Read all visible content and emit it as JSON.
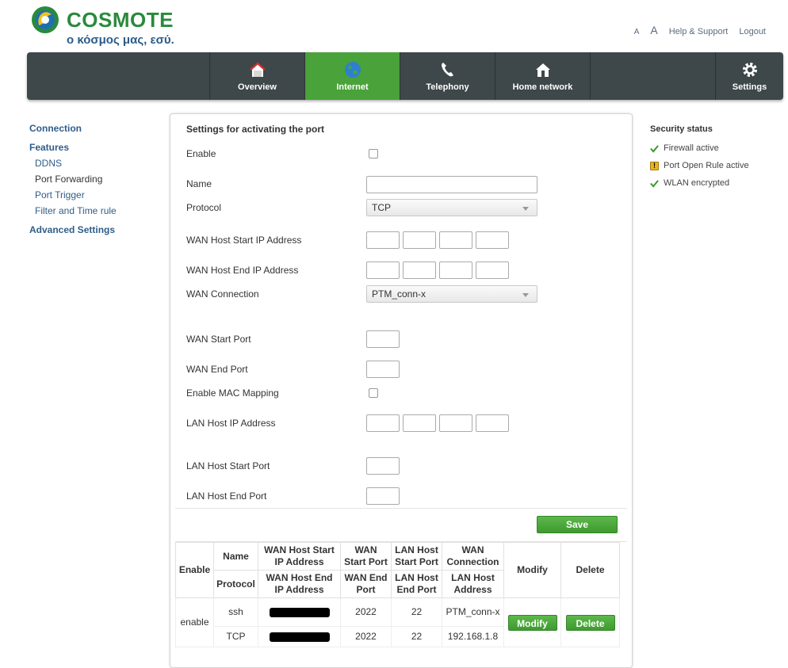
{
  "brand": {
    "name": "COSMOTE",
    "slogan": "ο κόσμος μας, εσύ."
  },
  "top_links": {
    "font_small": "A",
    "font_large": "A",
    "help": "Help & Support",
    "logout": "Logout"
  },
  "nav": {
    "overview": "Overview",
    "internet": "Internet",
    "telephony": "Telephony",
    "home_network": "Home network",
    "settings": "Settings",
    "active_color": "#4aa23a"
  },
  "sidebar": {
    "connection": "Connection",
    "features": "Features",
    "items": [
      "DDNS",
      "Port Forwarding",
      "Port Trigger",
      "Filter and Time rule"
    ],
    "advanced": "Advanced Settings"
  },
  "form": {
    "title": "Settings for activating the port",
    "enable": "Enable",
    "name": "Name",
    "protocol": "Protocol",
    "protocol_value": "TCP",
    "wan_start_ip": "WAN Host Start IP Address",
    "wan_end_ip": "WAN Host End IP Address",
    "wan_connection": "WAN Connection",
    "wan_connection_value": "PTM_conn-x",
    "wan_start_port": "WAN Start Port",
    "wan_end_port": "WAN End Port",
    "enable_mac": "Enable MAC Mapping",
    "lan_ip": "LAN Host IP Address",
    "lan_start_port": "LAN Host Start Port",
    "lan_end_port": "LAN Host End Port",
    "save": "Save"
  },
  "table": {
    "h_enable": "Enable",
    "h_name": "Name",
    "h_wan_start_ip": "WAN Host Start IP Address",
    "h_wan_start_port": "WAN Start Port",
    "h_lan_start_port": "LAN Host Start Port",
    "h_wan_conn": "WAN Connection",
    "h_modify": "Modify",
    "h_delete": "Delete",
    "h_protocol": "Protocol",
    "h_wan_end_ip": "WAN Host End IP Address",
    "h_wan_end_port": "WAN End Port",
    "h_lan_end_port": "LAN Host End Port",
    "h_lan_ip": "LAN Host Address",
    "row": {
      "enable": "enable",
      "name": "ssh",
      "protocol": "TCP",
      "wan_start_port": "2022",
      "wan_end_port": "2022",
      "lan_start_port": "22",
      "lan_end_port": "22",
      "wan_conn": "PTM_conn-x",
      "lan_ip": "192.168.1.8",
      "modify": "Modify",
      "delete": "Delete"
    }
  },
  "security": {
    "title": "Security status",
    "items": [
      "Firewall active",
      "Port Open Rule active",
      "WLAN encrypted"
    ]
  }
}
